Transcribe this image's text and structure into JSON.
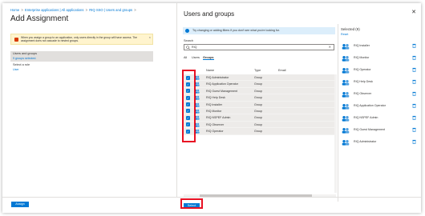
{
  "breadcrumb": [
    "Home",
    "Enterprise applications | All applications",
    "RIQ SSO | Users and groups"
  ],
  "left": {
    "title": "Add Assignment",
    "warning": "When you assign a group to an application, only users directly in the group will have access. The assignment does not cascade to nested groups.",
    "users_groups_title": "Users and groups",
    "users_groups_value": "9 groups selected.",
    "role_title": "Select a role",
    "role_value": "User",
    "assign_label": "Assign"
  },
  "right": {
    "title": "Users and groups",
    "info": "Try changing or adding filters if you don't see what you're looking for.",
    "search_label": "Search",
    "search_value": "RIQ",
    "tabs": [
      {
        "label": "All"
      },
      {
        "label": "Users"
      },
      {
        "label": "Groups"
      }
    ],
    "columns": {
      "name": "Name",
      "type": "Type",
      "email": "Email"
    },
    "rows": [
      {
        "name": "RIQ Administrator",
        "type": "Group"
      },
      {
        "name": "RIQ Application Operator",
        "type": "Group"
      },
      {
        "name": "RIQ Guest Management",
        "type": "Group"
      },
      {
        "name": "RIQ Help Desk",
        "type": "Group"
      },
      {
        "name": "RIQ Installer",
        "type": "Group"
      },
      {
        "name": "RIQ Monitor",
        "type": "Group"
      },
      {
        "name": "RIQ NSPEF Admin",
        "type": "Group"
      },
      {
        "name": "RIQ Observer",
        "type": "Group"
      },
      {
        "name": "RIQ Operator",
        "type": "Group"
      }
    ],
    "selected_title": "Selected (9)",
    "reset_label": "Reset",
    "selected": [
      {
        "label": "RIQ Installer"
      },
      {
        "label": "RIQ Monitor"
      },
      {
        "label": "RIQ Operator"
      },
      {
        "label": "RIQ Help Desk"
      },
      {
        "label": "RIQ Observer"
      },
      {
        "label": "RIQ Application Operator"
      },
      {
        "label": "RIQ NSPEF Admin"
      },
      {
        "label": "RIQ Guest Management"
      },
      {
        "label": "RIQ Administrator"
      }
    ],
    "select_label": "Select"
  },
  "colors": {
    "accent": "#0078d4",
    "highlight": "#e81123",
    "warning_bg": "#fff4ce",
    "info_bg": "#dceefb"
  },
  "icons": {
    "close": "close-icon",
    "search": "search-icon",
    "group": "group-icon",
    "delete": "trash-icon",
    "info": "info-icon",
    "warning": "warning-icon"
  }
}
